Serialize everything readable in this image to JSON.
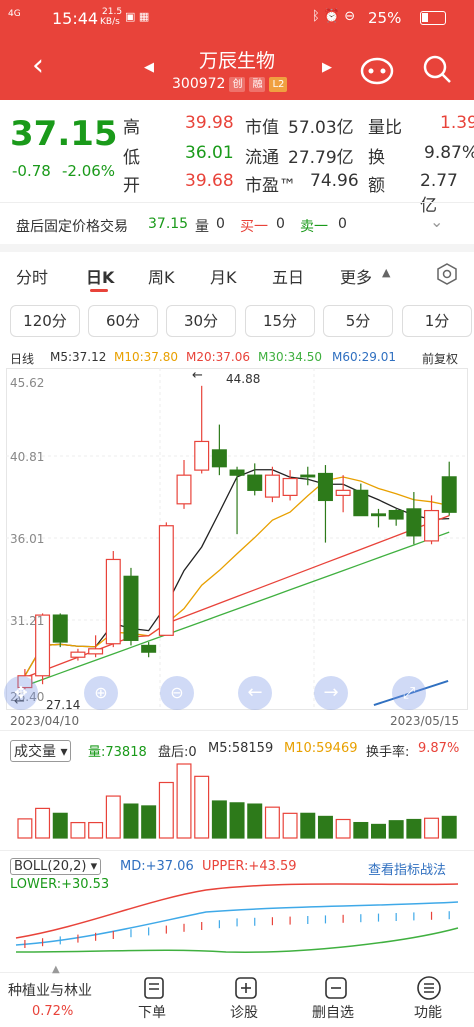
{
  "status": {
    "time": "15:44",
    "net": "4G",
    "speed_top": "21.5",
    "speed_bot": "KB/s",
    "battery": "25%"
  },
  "header": {
    "title": "万辰生物",
    "code": "300972",
    "badge_chuang": "创",
    "badge_rong": "融",
    "badge_l2": "L2"
  },
  "quote": {
    "price": "37.15",
    "change": "-0.78",
    "pct": "-2.06%",
    "rows": [
      {
        "k1": "高",
        "v1": "39.98",
        "k2": "市值",
        "v2": "57.03亿",
        "k3": "量比",
        "v3": "1.39"
      },
      {
        "k1": "低",
        "v1": "36.01",
        "k2": "流通",
        "v2": "27.79亿",
        "k3": "换",
        "v3": "9.87%"
      },
      {
        "k1": "开",
        "v1": "39.68",
        "k2": "市盈™",
        "v2": "74.96",
        "k3": "额",
        "v3": "2.77亿"
      }
    ]
  },
  "after": {
    "label": "盘后固定价格交易",
    "price": "37.15",
    "vol_label": "量",
    "vol": "0",
    "buy_label": "买一",
    "buy": "0",
    "sell_label": "卖一",
    "sell": "0"
  },
  "tabs": [
    "分时",
    "日K",
    "周K",
    "月K",
    "五日",
    "更多"
  ],
  "periods": [
    "120分",
    "60分",
    "30分",
    "15分",
    "5分",
    "1分"
  ],
  "ma_legend": {
    "label": "日线",
    "m5": "M5:37.12",
    "m10": "M10:37.80",
    "m20": "M20:37.06",
    "m30": "M30:34.50",
    "m60": "M60:29.01",
    "adj": "前复权"
  },
  "axis": {
    "p1": "45.62",
    "p2": "40.81",
    "p3": "36.01",
    "p4": "31.21",
    "p5": "26.40",
    "hi_mark": "44.88",
    "lo_mark": "27.14",
    "d_start": "2023/04/10",
    "d_end": "2023/05/15"
  },
  "vol_legend": {
    "label": "成交量",
    "vol": "量:73818",
    "after": "盘后:0",
    "m5": "M5:58159",
    "m10": "M10:59469",
    "turn_label": "换手率:",
    "turn": "9.87%"
  },
  "boll_legend": {
    "label": "BOLL(20,2)",
    "md": "MD:+37.06",
    "upper": "UPPER:+43.59",
    "lower": "LOWER:+30.53",
    "link": "查看指标战法"
  },
  "nav": {
    "sector": "种植业与林业",
    "sector_pct": "0.72%",
    "items": [
      "下单",
      "诊股",
      "删自选",
      "功能"
    ]
  },
  "colors": {
    "up": "#e8433a",
    "down": "#2d7a1a"
  },
  "chart_data": {
    "type": "candlestick",
    "dates_start": "2023/04/10",
    "dates_end": "2023/05/15",
    "candles": [
      [
        26.9,
        28.0,
        26.8,
        27.6
      ],
      [
        27.6,
        31.3,
        27.1,
        31.2
      ],
      [
        31.2,
        31.3,
        29.3,
        29.6
      ],
      [
        28.7,
        29.2,
        28.5,
        29.0
      ],
      [
        28.9,
        30.0,
        28.7,
        29.2
      ],
      [
        29.5,
        35.0,
        29.3,
        34.5
      ],
      [
        33.5,
        34.0,
        29.4,
        29.7
      ],
      [
        29.4,
        29.6,
        28.7,
        29.0
      ],
      [
        30.0,
        36.7,
        30.0,
        36.5
      ],
      [
        37.8,
        40.4,
        37.5,
        39.5
      ],
      [
        39.8,
        44.8,
        39.6,
        41.5
      ],
      [
        41.0,
        42.5,
        39.5,
        40.0
      ],
      [
        39.8,
        40.0,
        36.0,
        39.5
      ],
      [
        39.5,
        40.2,
        38.3,
        38.6
      ],
      [
        38.2,
        40.0,
        37.9,
        39.5
      ],
      [
        38.3,
        39.8,
        38.0,
        39.3
      ],
      [
        39.5,
        40.0,
        38.9,
        39.4
      ],
      [
        39.6,
        40.1,
        35.5,
        38.0
      ],
      [
        38.3,
        39.5,
        37.3,
        38.6
      ],
      [
        38.6,
        39.0,
        37.2,
        37.1
      ],
      [
        37.2,
        37.5,
        36.4,
        37.1
      ],
      [
        37.4,
        37.5,
        36.5,
        36.9
      ],
      [
        37.5,
        38.5,
        35.4,
        35.9
      ],
      [
        35.6,
        38.3,
        35.4,
        37.4
      ],
      [
        39.4,
        40.3,
        37.1,
        37.3
      ]
    ],
    "volume": [
      31000,
      48000,
      40000,
      25000,
      25000,
      68000,
      55000,
      52000,
      90000,
      120000,
      100000,
      60000,
      57000,
      55000,
      50000,
      40000,
      40000,
      35000,
      30000,
      25000,
      22000,
      28000,
      30000,
      32000,
      35000
    ]
  }
}
